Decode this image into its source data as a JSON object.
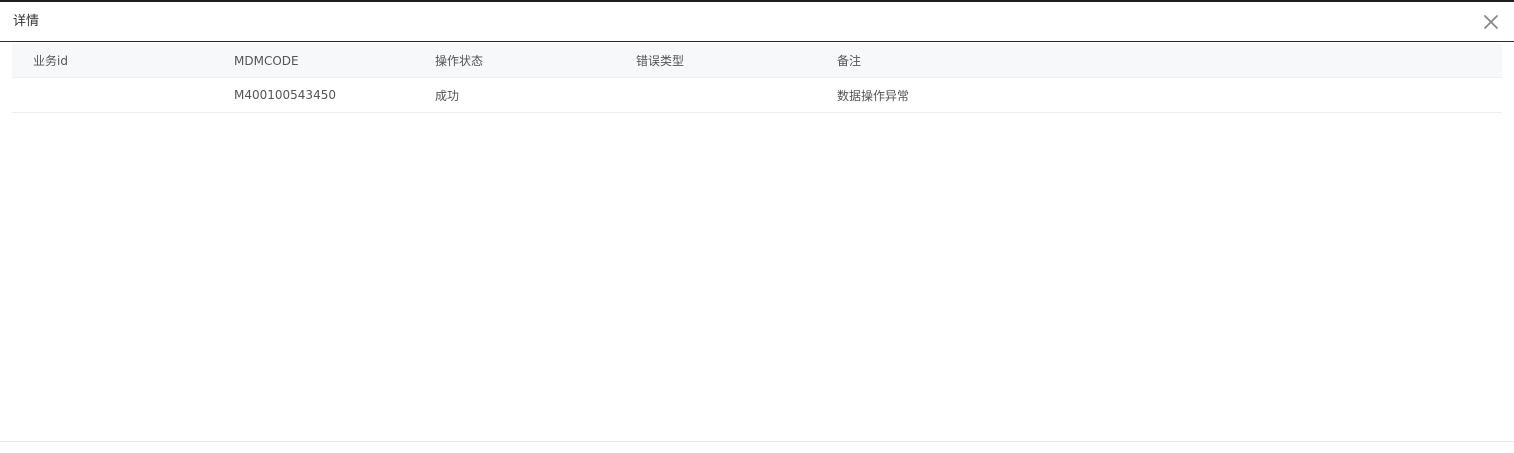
{
  "dialog": {
    "title": "详情",
    "close_icon": "close-icon"
  },
  "table": {
    "columns": [
      "业务id",
      "MDMCODE",
      "操作状态",
      "错误类型",
      "备注"
    ],
    "rows": [
      [
        "",
        "M400100543450",
        "成功",
        "",
        "数据操作异常"
      ]
    ]
  },
  "colors": {
    "header_border": "#2b3038",
    "table_header_bg": "#f7f8fa",
    "row_border": "#ebeef5"
  }
}
